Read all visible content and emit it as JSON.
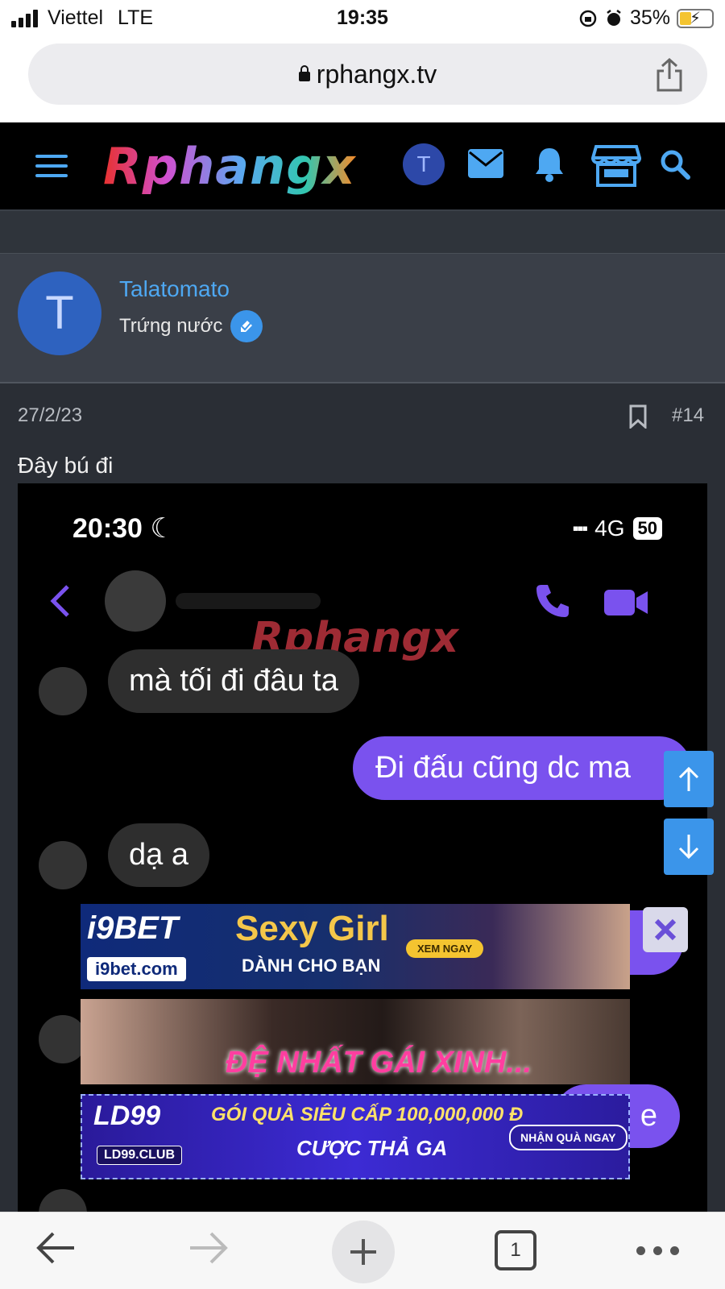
{
  "status_bar": {
    "carrier": "Viettel",
    "network": "LTE",
    "time": "19:35",
    "battery": "35%"
  },
  "browser": {
    "url": "rphangx.tv"
  },
  "site": {
    "logo_text": "Rphangx",
    "user_initial": "T"
  },
  "post": {
    "avatar_initial": "T",
    "username": "Talatomato",
    "user_title": "Trứng nước",
    "date": "27/2/23",
    "number": "#14",
    "text": "Đây bú đi"
  },
  "embedded_chat": {
    "time": "20:30",
    "network": "4G",
    "battery": "50",
    "watermark": "Rphangx",
    "messages": [
      {
        "dir": "in",
        "text": "mà tối đi đâu ta"
      },
      {
        "dir": "out",
        "text": "Đi đấu cũng dc ma"
      },
      {
        "dir": "in",
        "text": "dạ a"
      },
      {
        "dir": "out",
        "text": "e"
      }
    ]
  },
  "ads": [
    {
      "brand": "i9BET",
      "site": "i9bet.com",
      "headline": "Sexy Girl",
      "sub": "DÀNH CHO BẠN",
      "cta": "XEM NGAY"
    },
    {
      "headline": "ĐỆ NHẤT GÁI XINH..."
    },
    {
      "brand": "LD99",
      "site": "LD99.CLUB",
      "line1": "GÓI QUÀ SIÊU CẤP 100,000,000 Đ",
      "line2": "CƯỢC THẢ GA",
      "cta": "NHẬN QUÀ NGAY"
    }
  ],
  "toolbar": {
    "tab_count": "1"
  },
  "colors": {
    "accent_blue": "#3b95ea",
    "link_blue": "#4ea8f2",
    "chat_purple": "#7a52ee",
    "content_bg": "#2a2e35"
  }
}
